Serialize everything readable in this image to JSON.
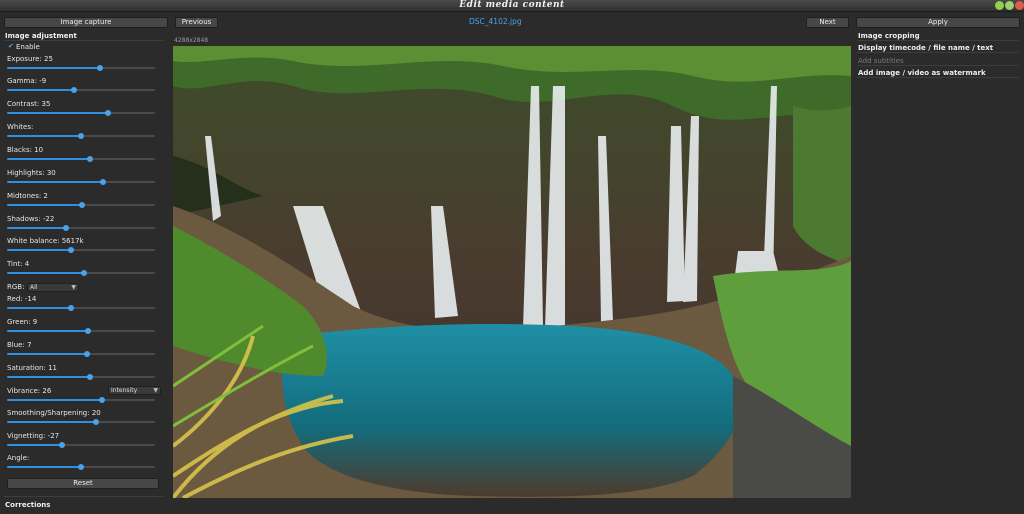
{
  "window": {
    "title": "Edit media content"
  },
  "toolbar": {
    "image_capture": "Image capture",
    "previous": "Previous",
    "filename": "DSC_4102.jpg",
    "next": "Next",
    "apply": "Apply"
  },
  "image": {
    "dimensions": "4288x2848"
  },
  "adjustment": {
    "section_title": "Image adjustment",
    "enable_label": "Enable",
    "enabled": true,
    "sliders": [
      {
        "label": "Exposure: 25",
        "level": 0.63
      },
      {
        "label": "Gamma: -9",
        "level": 0.45
      },
      {
        "label": "Contrast: 35",
        "level": 0.68
      },
      {
        "label": "Whites:",
        "level": 0.5
      },
      {
        "label": "Blacks: 10",
        "level": 0.56
      },
      {
        "label": "Highlights: 30",
        "level": 0.65
      },
      {
        "label": "Midtones: 2",
        "level": 0.51
      },
      {
        "label": "Shadows: -22",
        "level": 0.4
      },
      {
        "label": "White balance: 5617k",
        "level": 0.43
      },
      {
        "label": "Tint: 4",
        "level": 0.52
      },
      {
        "label": "Red: -14",
        "level": 0.43
      },
      {
        "label": "Green: 9",
        "level": 0.55
      },
      {
        "label": "Blue: 7",
        "level": 0.54
      },
      {
        "label": "Saturation: 11",
        "level": 0.56
      },
      {
        "label": "Vibrance: 26",
        "level": 0.64
      },
      {
        "label": "Smoothing/Sharpening: 20",
        "level": 0.6
      },
      {
        "label": "Vignetting: -27",
        "level": 0.37
      },
      {
        "label": "Angle:",
        "level": 0.5
      }
    ],
    "rgb_label": "RGB:",
    "rgb_value": "All",
    "vibrance_mode": "Intensity",
    "reset": "Reset"
  },
  "corrections": {
    "section_title": "Corrections"
  },
  "right_panel": {
    "items": [
      {
        "label": "Image cropping",
        "enabled": true
      },
      {
        "label": "Display timecode / file name / text",
        "enabled": true
      },
      {
        "label": "Add subtitles",
        "enabled": false
      },
      {
        "label": "Add image / video as watermark",
        "enabled": true
      }
    ]
  },
  "colors": {
    "accent": "#2f8fe0",
    "panel": "#2b2b2b"
  }
}
